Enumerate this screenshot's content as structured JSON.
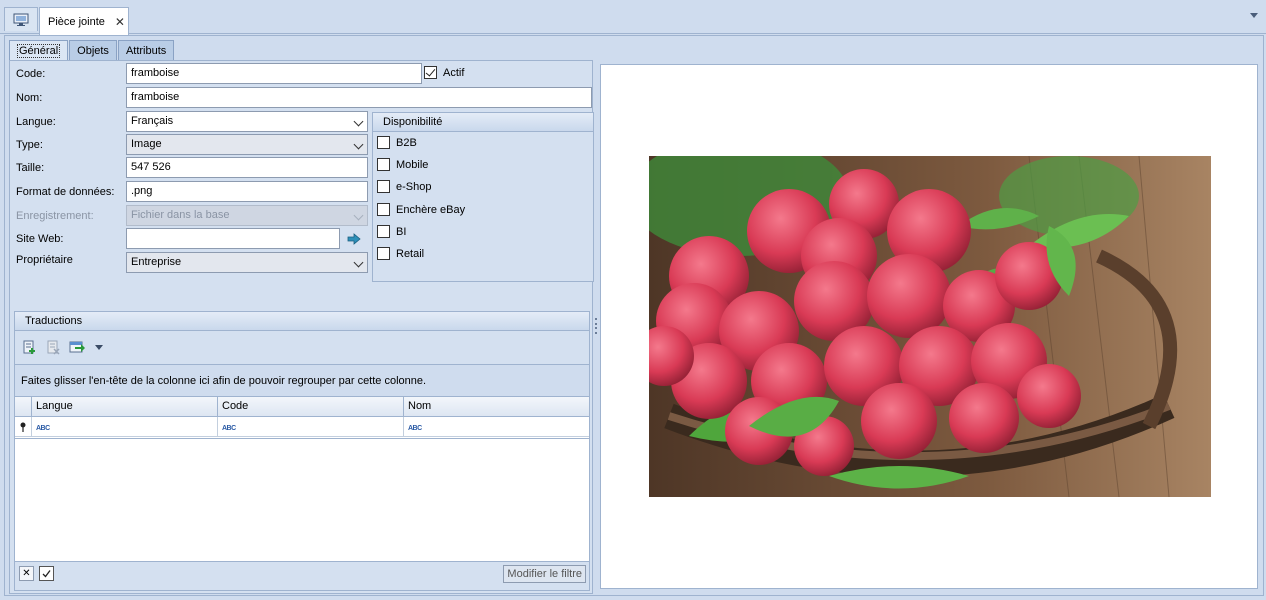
{
  "window": {
    "tab_title": "Pièce jointe",
    "close_glyph": "✕"
  },
  "subtabs": [
    "Général",
    "Objets",
    "Attributs"
  ],
  "form": {
    "code_label": "Code:",
    "code_value": "framboise",
    "actif_label": "Actif",
    "actif_checked": true,
    "nom_label": "Nom:",
    "nom_value": "framboise",
    "langue_label": "Langue:",
    "langue_value": "Français",
    "type_label": "Type:",
    "type_value": "Image",
    "taille_label": "Taille:",
    "taille_value": "547 526",
    "format_label": "Format de données:",
    "format_value": ".png",
    "enregistrement_label": "Enregistrement:",
    "enregistrement_value": "Fichier dans la base",
    "siteweb_label": "Site Web:",
    "siteweb_value": "",
    "proprietaire_label": "Propriétaire",
    "proprietaire_value": "Entreprise"
  },
  "disponibilite": {
    "title": "Disponibilité",
    "items": [
      "B2B",
      "Mobile",
      "e-Shop",
      "Enchère eBay",
      "BI",
      "Retail"
    ]
  },
  "traductions": {
    "title": "Traductions",
    "group_hint": "Faites glisser l'en-tête de la colonne ici afin de pouvoir regrouper par cette colonne.",
    "columns": [
      "Langue",
      "Code",
      "Nom"
    ],
    "filter_placeholder": "ABC",
    "modify_filter_label": "Modifier le filtre"
  },
  "colors": {
    "frame_bg": "#cfdcee",
    "panel_bg": "#d4e0f0",
    "border": "#9fb3cf",
    "arrow_blue": "#2d6fb8",
    "raspberry": "#d93a55"
  }
}
